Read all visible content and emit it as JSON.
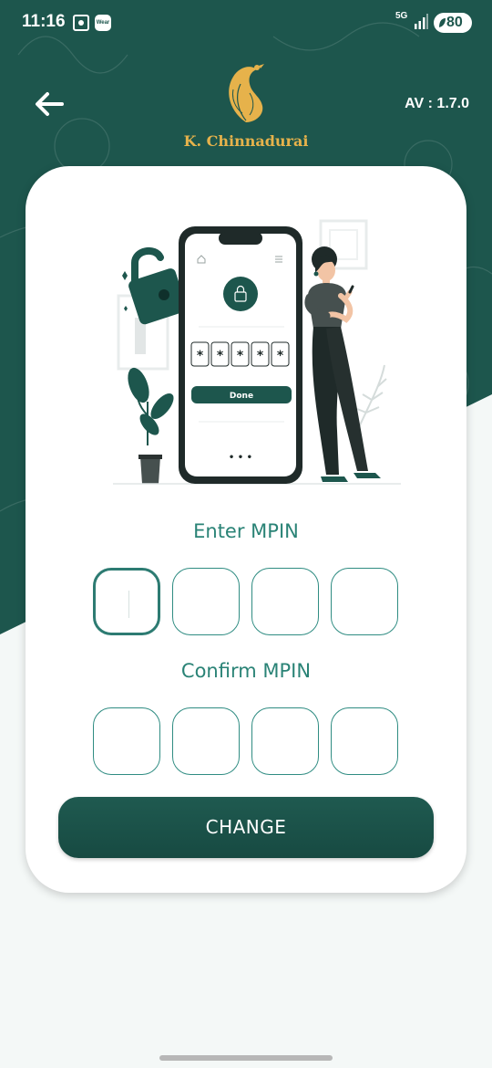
{
  "status_bar": {
    "time": "11:16",
    "network": "5G",
    "battery": "80",
    "notification_badge": "Wear"
  },
  "header": {
    "brand_name": "K. Chinnadurai",
    "app_version": "AV : 1.7.0",
    "back_icon": "arrow-left-icon",
    "logo_icon": "peacock-feather-logo"
  },
  "illustration": {
    "otp_digits": [
      "*",
      "*",
      "*",
      "*",
      "*"
    ],
    "done_label": "Done",
    "menu_dots": "• • •"
  },
  "form": {
    "enter_label": "Enter MPIN",
    "confirm_label": "Confirm MPIN",
    "enter_mpin": [
      "",
      "",
      "",
      ""
    ],
    "confirm_mpin": [
      "",
      "",
      "",
      ""
    ],
    "submit_label": "CHANGE"
  },
  "colors": {
    "primary": "#1d564d",
    "accent_gold": "#e6b24b",
    "label_teal": "#2a8376",
    "pin_border": "#2f8c82"
  }
}
